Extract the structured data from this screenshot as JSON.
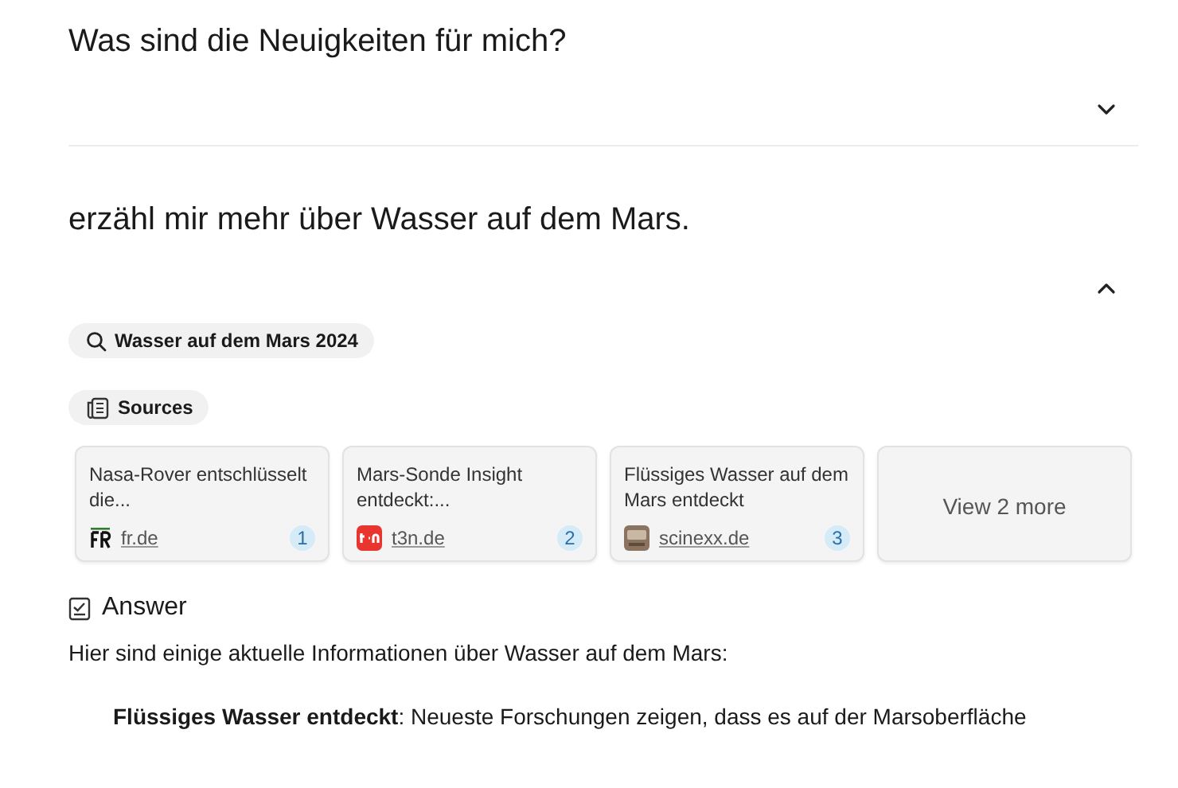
{
  "threads": [
    {
      "question": "Was sind die Neuigkeiten für mich?",
      "expanded": false
    },
    {
      "question": "erzähl mir mehr über Wasser auf dem Mars.",
      "expanded": true,
      "search_query": "Wasser auf dem Mars 2024",
      "sources_label": "Sources",
      "sources": [
        {
          "title": "Nasa-Rover entschlüsselt die...",
          "site": "fr.de",
          "number": "1",
          "kind": "fr"
        },
        {
          "title": "Mars-Sonde Insight entdeckt:...",
          "site": "t3n.de",
          "number": "2",
          "kind": "t3n"
        },
        {
          "title": "Flüssiges Wasser auf dem Mars entdeckt",
          "site": "scinexx.de",
          "number": "3",
          "kind": "scinexx"
        }
      ],
      "more_button": "View 2 more",
      "answer_label": "Answer",
      "answer_intro": "Hier sind einige aktuelle Informationen über Wasser auf dem Mars:",
      "answer_points": [
        "**Flüssiges Wasser entdeckt**: Neueste Forschungen zeigen, dass es auf der Marsoberfläche"
      ]
    }
  ]
}
